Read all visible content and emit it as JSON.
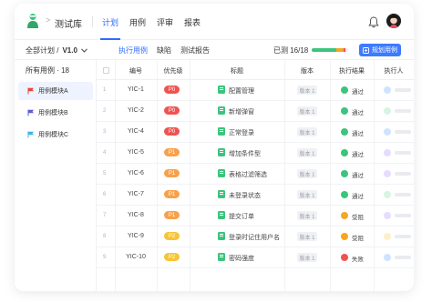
{
  "header": {
    "app_title": "测试库",
    "tabs": [
      "计划",
      "用例",
      "评审",
      "报表"
    ],
    "active_tab": 0
  },
  "subbar": {
    "plan_prefix": "全部计划 /",
    "plan_version": "V1.0",
    "tabs": [
      "执行用例",
      "缺陷",
      "测试报告"
    ],
    "active_tab": 0,
    "done_label": "已测 16/18",
    "progress": {
      "pass": 0.67,
      "blocked": 0.2,
      "fail": 0.06
    },
    "plan_button": "规划用例"
  },
  "sidebar": {
    "all_label": "所有用例 · 18",
    "items": [
      {
        "label": "用例模块A",
        "flag_color": "#e8453c",
        "active": true
      },
      {
        "label": "用例模块B",
        "flag_color": "#5b5bdc",
        "active": false
      },
      {
        "label": "用例模块C",
        "flag_color": "#3cb6e8",
        "active": false
      }
    ]
  },
  "table": {
    "columns": [
      "编号",
      "优先级",
      "标题",
      "版本",
      "执行结果",
      "执行人"
    ],
    "rows": [
      {
        "n": "1",
        "id": "YIC-1",
        "prio": "P0",
        "title": "配置管理",
        "ver": "版本 1",
        "result": "通过",
        "rcolor": "#3cc47c",
        "ucolor": "#cfe3ff"
      },
      {
        "n": "2",
        "id": "YIC-2",
        "prio": "P0",
        "title": "新增弹窗",
        "ver": "版本 1",
        "result": "通过",
        "rcolor": "#3cc47c",
        "ucolor": "#d6f5e3"
      },
      {
        "n": "3",
        "id": "YIC-4",
        "prio": "P0",
        "title": "正常登录",
        "ver": "版本 1",
        "result": "通过",
        "rcolor": "#3cc47c",
        "ucolor": "#cfe3ff"
      },
      {
        "n": "4",
        "id": "YIC-5",
        "prio": "P1",
        "title": "增加条件型",
        "ver": "版本 1",
        "result": "通过",
        "rcolor": "#3cc47c",
        "ucolor": "#e6dcff"
      },
      {
        "n": "5",
        "id": "YIC-6",
        "prio": "P1",
        "title": "表格过滤筛选",
        "ver": "版本 1",
        "result": "通过",
        "rcolor": "#3cc47c",
        "ucolor": "#e6dcff"
      },
      {
        "n": "6",
        "id": "YIC-7",
        "prio": "P1",
        "title": "未登录状态",
        "ver": "版本 1",
        "result": "通过",
        "rcolor": "#3cc47c",
        "ucolor": "#d6f5e3"
      },
      {
        "n": "7",
        "id": "YIC-8",
        "prio": "P1",
        "title": "提交订单",
        "ver": "版本 1",
        "result": "受阻",
        "rcolor": "#f5a623",
        "ucolor": "#e6dcff"
      },
      {
        "n": "8",
        "id": "YIC-9",
        "prio": "P2",
        "title": "登录时记住用户名",
        "ver": "版本 1",
        "result": "受阻",
        "rcolor": "#f5a623",
        "ucolor": "#fdf0c8"
      },
      {
        "n": "9",
        "id": "YIC-10",
        "prio": "P2",
        "title": "密码强度",
        "ver": "版本 1",
        "result": "失败",
        "rcolor": "#ef5350",
        "ucolor": "#cfe3ff"
      }
    ]
  },
  "colors": {
    "accent": "#2f6bff",
    "P0": "#ef5350",
    "P1": "#f7a14b",
    "P2": "#f6c435"
  }
}
